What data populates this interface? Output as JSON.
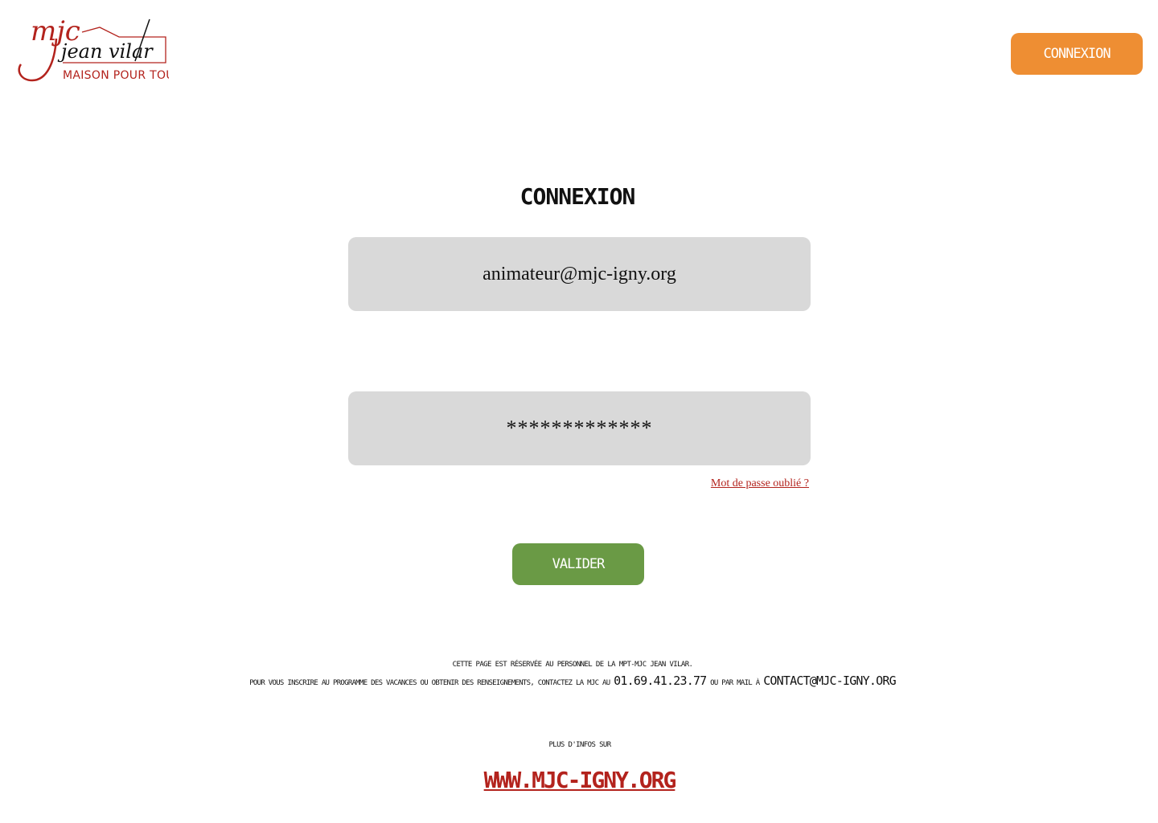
{
  "logo": {
    "line1": "mjc",
    "line2": "jean vilar",
    "line3": "MAISON POUR TOUS",
    "color": "#b3231d"
  },
  "header": {
    "login_button_label": "Connexion",
    "login_button_color": "#ee8e33"
  },
  "form": {
    "title": "Connexion",
    "email_value": "animateur@mjc-igny.org",
    "password_value": "*************",
    "forgot_password_label": "Mot de passe oublié ?",
    "submit_label": "Valider",
    "submit_color": "#6a9a45",
    "field_background": "#d9d9d9"
  },
  "footer": {
    "notice": "Cette page est réservée au personnel de la MPT-MJC Jean Vilar.",
    "contact_prefix": "Pour vous inscrire au programme des vacances ou obtenir des renseignements, contactez la MJC au",
    "phone": "01.69.41.23.77",
    "contact_middle": "ou par mail à",
    "email": "contact@mjc-igny.org",
    "more_info": "Plus d'infos sur",
    "website": "www.mjc-igny.org"
  }
}
